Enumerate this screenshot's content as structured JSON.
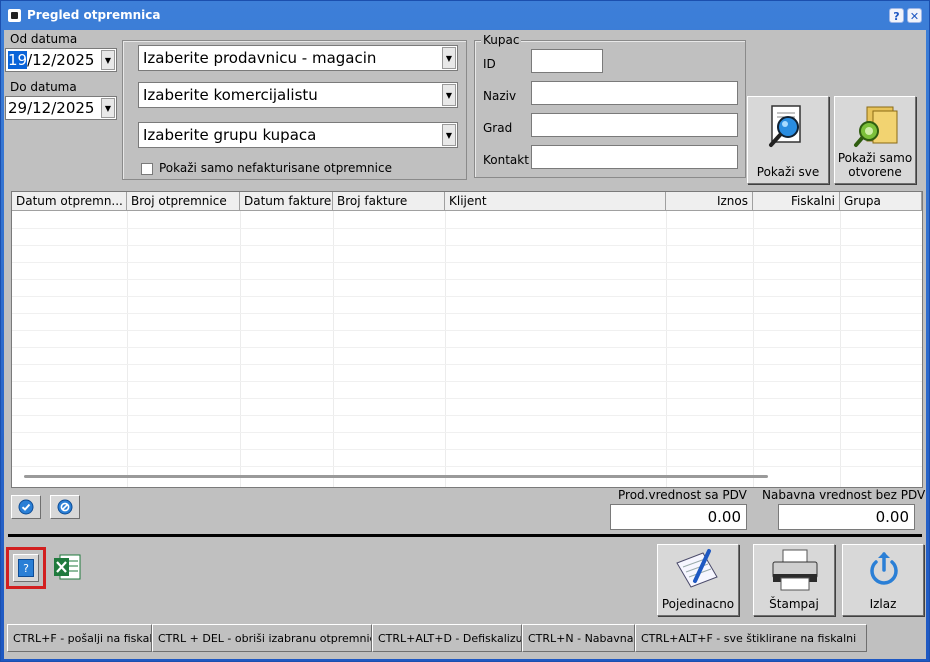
{
  "window": {
    "title": "Pregled otpremnica"
  },
  "titlebar_buttons": {
    "help": "?",
    "close": "✕"
  },
  "dates": {
    "from_label": "Od datuma",
    "from_day": "19",
    "from_rest": "/12/2025",
    "to_label": "Do datuma",
    "to_value": "29/12/2025"
  },
  "filters": {
    "store": "Izaberite prodavnicu - magacin",
    "salesperson": "Izaberite komercijalistu",
    "customer_group": "Izaberite grupu kupaca",
    "only_uninvoiced": "Pokaži samo nefakturisane otpremnice"
  },
  "customer": {
    "group_title": "Kupac",
    "id_label": "ID",
    "name_label": "Naziv",
    "city_label": "Grad",
    "contact_label": "Kontakt",
    "id_value": "",
    "name_value": "",
    "city_value": "",
    "contact_value": ""
  },
  "actions": {
    "show_all": "Pokaži sve",
    "show_open_line1": "Pokaži samo",
    "show_open_line2": "otvorene"
  },
  "table": {
    "columns": [
      "Datum otpremn...",
      "Broj otpremnice",
      "Datum fakture",
      "Broj fakture",
      "Klijent",
      "Iznos",
      "Fiskalni",
      "Grupa"
    ],
    "rows": []
  },
  "totals": {
    "retail_label": "Prod.vrednost sa PDV",
    "retail_value": "0.00",
    "purchase_label": "Nabavna vrednost bez PDV",
    "purchase_value": "0.00"
  },
  "bottom_buttons": {
    "single": "Pojedinacno",
    "print": "Štampaj",
    "exit": "Izlaz",
    "help": "?"
  },
  "shortcuts": [
    "CTRL+F - pošalji na fiskalni",
    "CTRL + DEL - obriši izabranu otpremnicu",
    "CTRL+ALT+D - Defiskalizuj",
    "CTRL+N - Nabavna",
    "CTRL+ALT+F - sve štiklirane na fiskalni"
  ],
  "colors": {
    "titlebar": "#1e58c2",
    "face": "#c0c0c0",
    "highlight": "#d21f1f",
    "excel": "#1f7a3d"
  }
}
